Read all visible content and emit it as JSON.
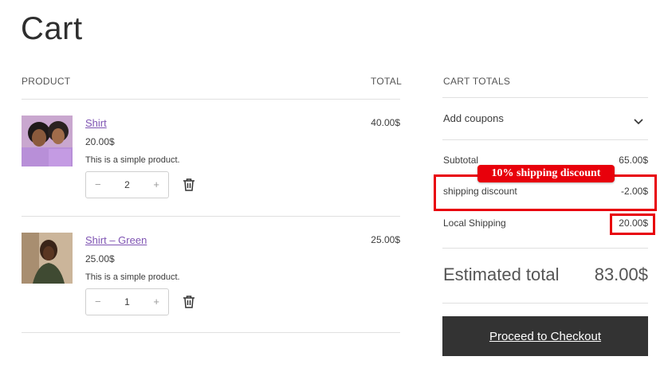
{
  "page": {
    "title": "Cart"
  },
  "products": {
    "header_product": "PRODUCT",
    "header_total": "TOTAL",
    "items": [
      {
        "name": "Shirt",
        "price": "20.00$",
        "description": "This is a simple product.",
        "quantity": "2",
        "total": "40.00$"
      },
      {
        "name": "Shirt – Green",
        "price": "25.00$",
        "description": "This is a simple product.",
        "quantity": "1",
        "total": "25.00$"
      }
    ],
    "qty_minus": "−",
    "qty_plus": "+"
  },
  "totals": {
    "header": "CART TOTALS",
    "coupons_label": "Add coupons",
    "subtotal_label": "Subtotal",
    "subtotal_value": "65.00$",
    "discount_label": "shipping discount",
    "discount_value": "-2.00$",
    "shipping_label": "Local Shipping",
    "shipping_value": "20.00$",
    "estimated_label": "Estimated total",
    "estimated_value": "83.00$",
    "checkout_label": "Proceed to Checkout"
  },
  "annotation": {
    "tag": "10% shipping discount",
    "color": "#e8000b"
  },
  "colors": {
    "link": "#7f54b3",
    "checkout_bg": "#333333"
  }
}
